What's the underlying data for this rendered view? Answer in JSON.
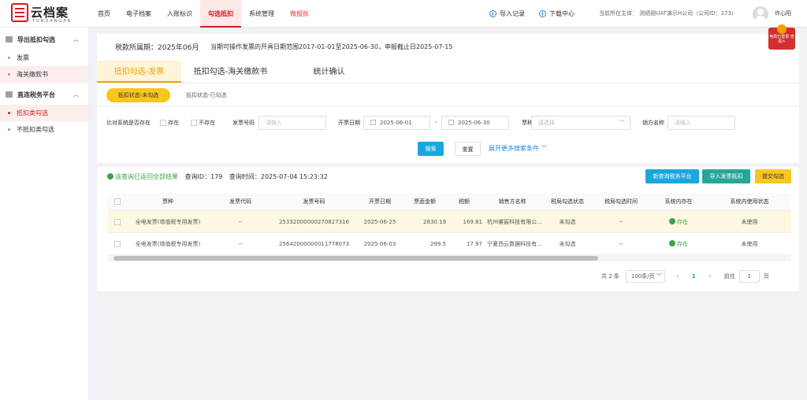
{
  "logo": {
    "text": "云档案",
    "sub": "YUNDANGAN"
  },
  "nav": [
    "首页",
    "电子档案",
    "入账标识",
    "勾选抵扣",
    "系统管理",
    "微报账"
  ],
  "topright": {
    "import_log": "导入记录",
    "download": "下载中心",
    "entity": "当前所在主体：  测绩刚UAT演示H公司（公司ID：173）",
    "user": "许心阳"
  },
  "side": {
    "group1": "导出抵扣勾选",
    "item_invoice": "发票",
    "item_customs": "海关缴款书",
    "group2": "直连税务平台",
    "item_deduct": "抵扣类勾选",
    "item_nondeduct": "不抵扣类勾选"
  },
  "header": {
    "period": "税款所属期：2025年06月",
    "note": "当期可操作发票的开具日期范围2017-01-01至2025-06-30，申报截止日2025-07-15",
    "badge": "电局已登录 查看>"
  },
  "tabs": [
    "抵扣勾选-发票",
    "抵扣勾选-海关缴款书",
    "统计确认"
  ],
  "subtabs": {
    "active": "抵扣状态-未勾选",
    "other": "抵扣状态-已勾选"
  },
  "filters": {
    "exist_label": "比对系统是否存在",
    "exist_yes": "存在",
    "exist_no": "不存在",
    "no_label": "发票号码",
    "no_ph": "请输入",
    "date_label": "开票日期",
    "date_from": "2025-06-01",
    "date_sep": "-",
    "date_to": "2025-06-30",
    "type_label": "票种",
    "type_ph": "请选择",
    "seller_label": "销方名称",
    "seller_ph": "请输入",
    "search": "搜索",
    "reset": "重置",
    "more": "展开更多搜索条件 ﹀"
  },
  "result": {
    "msg": "该查询已返回全部结果",
    "id": "查询ID：179",
    "time": "查询时间：2025-07-04 15:23:32"
  },
  "actions": {
    "platform": "新查询税务平台",
    "import": "导入发票抵扣",
    "submit": "提交勾选"
  },
  "colors": {
    "accent": "#d71920",
    "yellow": "#f9c51f",
    "blue": "#1aa7e0",
    "green": "#26a69a"
  },
  "table": {
    "headers": [
      "票种",
      "发票代码",
      "发票号码",
      "开票日期",
      "票面金额",
      "税额",
      "销售方名称",
      "税局勾选状态",
      "税局勾选时间",
      "系统内存在",
      "系统内使用状态"
    ],
    "rows": [
      [
        "全电发票(增值税专用发票)",
        "--",
        "25332000000270827316",
        "2025-06-25",
        "2830.19",
        "169.81",
        "杭州睿宸科技有限公...",
        "未勾选",
        "--",
        "存在",
        "未使用"
      ],
      [
        "全电发票(增值税专用发票)",
        "--",
        "25642000000011778073",
        "2025-06-03",
        "299.5",
        "17.97",
        "宁夏西云数据科技有...",
        "未勾选",
        "--",
        "存在",
        "未使用"
      ]
    ]
  },
  "pager": {
    "total": "共 2 条",
    "size": "100条/页 ﹀",
    "prev": "‹",
    "page": "1",
    "next": "›",
    "goto": "前往",
    "goto_val": "1",
    "unit": "页"
  }
}
